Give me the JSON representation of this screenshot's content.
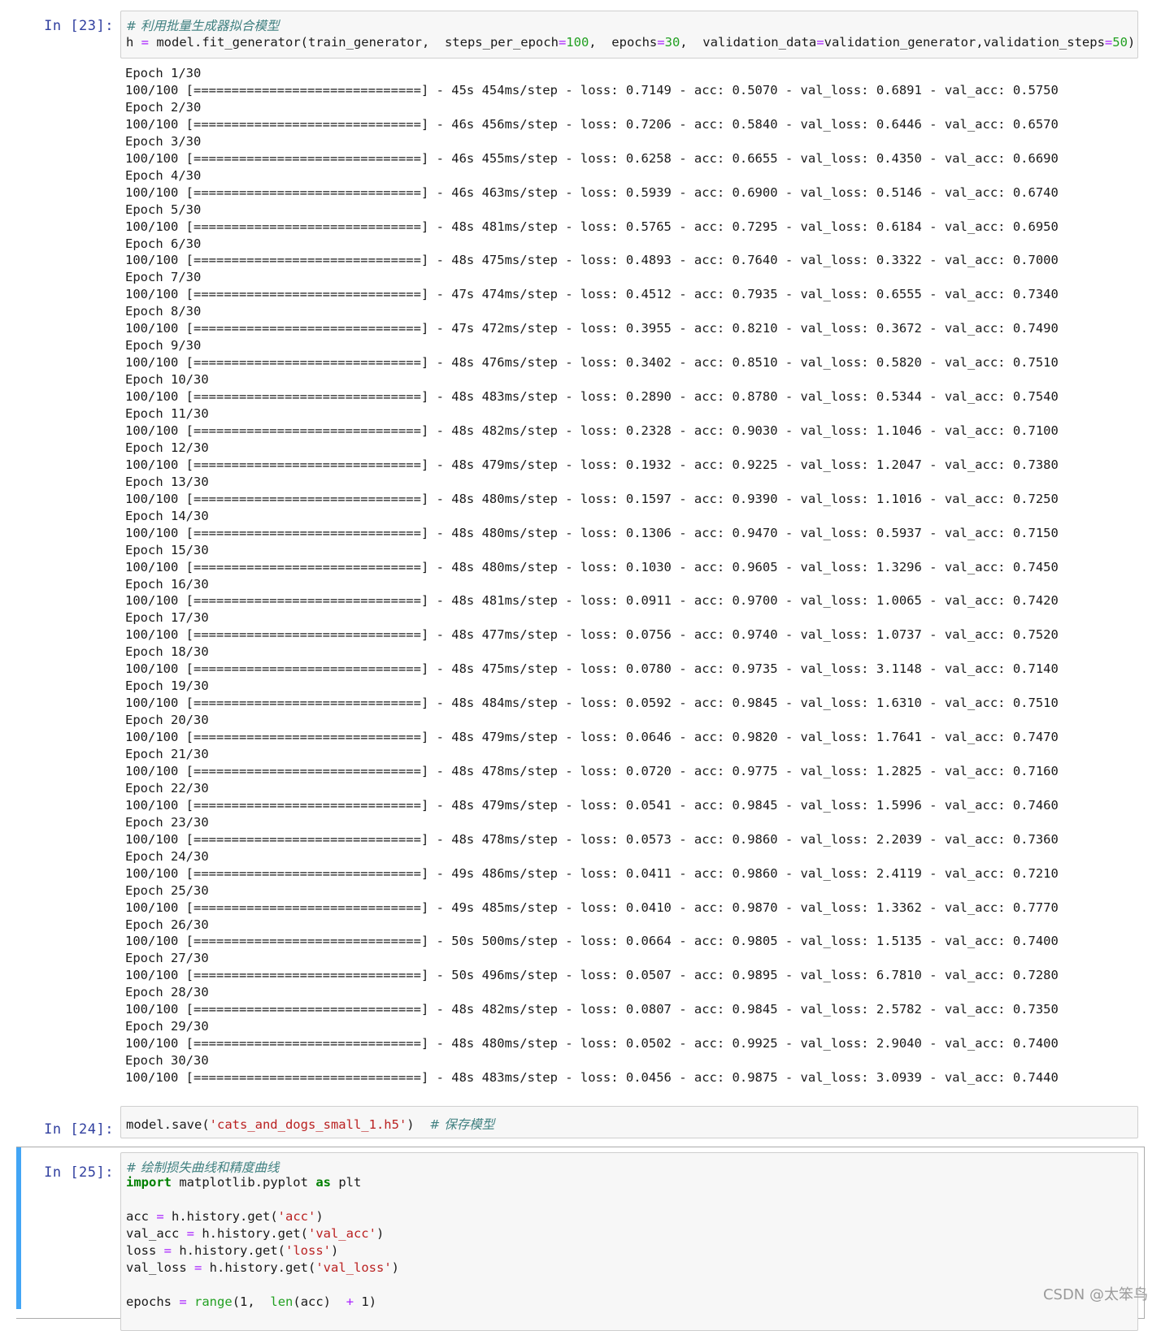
{
  "cells": [
    {
      "prompt": "In  [23]:",
      "code": {
        "comment": "# 利用批量生成器拟合模型",
        "line_prefix": "h ",
        "eq": "=",
        "call": " model.fit_generator(train_generator,  steps_per_epoch",
        "eq2": "=",
        "spe": "100",
        "c1": ",  epochs",
        "eq3": "=",
        "ep": "30",
        "c2": ",  validation_data",
        "eq4": "=",
        "vd": "validation_generator,validation_steps",
        "eq5": "=",
        "vs": "50",
        "close": ")"
      }
    },
    {
      "prompt": "In  [24]:",
      "code": {
        "pre": "model.save(",
        "str": "'cats_and_dogs_small_1.h5'",
        "post": ")  ",
        "comment": "# 保存模型"
      }
    },
    {
      "prompt": "In  [25]:",
      "code": {
        "comment": "# 绘制损失曲线和精度曲线",
        "import_kw": "import",
        "import_mod": " matplotlib.pyplot ",
        "as_kw": "as",
        "import_alias": " plt",
        "l1_pre": "acc ",
        "l1_post": " h.history.get(",
        "l1_str": "'acc'",
        "l2_pre": "val_acc ",
        "l2_post": " h.history.get(",
        "l2_str": "'val_acc'",
        "l3_pre": "loss ",
        "l3_post": " h.history.get(",
        "l3_str": "'loss'",
        "l4_pre": "val_loss ",
        "l4_post": " h.history.get(",
        "l4_str": "'val_loss'",
        "l5_pre": "epochs ",
        "l5_fn": "range",
        "l5_a": "(1,  ",
        "l5_fn2": "len",
        "l5_b": "(acc)  ",
        "l5_plus": "+",
        "l5_c": " 1)",
        "eq": "=",
        "close": ")"
      }
    }
  ],
  "training_output": [
    {
      "epoch": "Epoch 1/30",
      "progress": "100/100 [==============================] - 45s 454ms/step - loss: 0.7149 - acc: 0.5070 - val_loss: 0.6891 - val_acc: 0.5750"
    },
    {
      "epoch": "Epoch 2/30",
      "progress": "100/100 [==============================] - 46s 456ms/step - loss: 0.7206 - acc: 0.5840 - val_loss: 0.6446 - val_acc: 0.6570"
    },
    {
      "epoch": "Epoch 3/30",
      "progress": "100/100 [==============================] - 46s 455ms/step - loss: 0.6258 - acc: 0.6655 - val_loss: 0.4350 - val_acc: 0.6690"
    },
    {
      "epoch": "Epoch 4/30",
      "progress": "100/100 [==============================] - 46s 463ms/step - loss: 0.5939 - acc: 0.6900 - val_loss: 0.5146 - val_acc: 0.6740"
    },
    {
      "epoch": "Epoch 5/30",
      "progress": "100/100 [==============================] - 48s 481ms/step - loss: 0.5765 - acc: 0.7295 - val_loss: 0.6184 - val_acc: 0.6950"
    },
    {
      "epoch": "Epoch 6/30",
      "progress": "100/100 [==============================] - 48s 475ms/step - loss: 0.4893 - acc: 0.7640 - val_loss: 0.3322 - val_acc: 0.7000"
    },
    {
      "epoch": "Epoch 7/30",
      "progress": "100/100 [==============================] - 47s 474ms/step - loss: 0.4512 - acc: 0.7935 - val_loss: 0.6555 - val_acc: 0.7340"
    },
    {
      "epoch": "Epoch 8/30",
      "progress": "100/100 [==============================] - 47s 472ms/step - loss: 0.3955 - acc: 0.8210 - val_loss: 0.3672 - val_acc: 0.7490"
    },
    {
      "epoch": "Epoch 9/30",
      "progress": "100/100 [==============================] - 48s 476ms/step - loss: 0.3402 - acc: 0.8510 - val_loss: 0.5820 - val_acc: 0.7510"
    },
    {
      "epoch": "Epoch 10/30",
      "progress": "100/100 [==============================] - 48s 483ms/step - loss: 0.2890 - acc: 0.8780 - val_loss: 0.5344 - val_acc: 0.7540"
    },
    {
      "epoch": "Epoch 11/30",
      "progress": "100/100 [==============================] - 48s 482ms/step - loss: 0.2328 - acc: 0.9030 - val_loss: 1.1046 - val_acc: 0.7100"
    },
    {
      "epoch": "Epoch 12/30",
      "progress": "100/100 [==============================] - 48s 479ms/step - loss: 0.1932 - acc: 0.9225 - val_loss: 1.2047 - val_acc: 0.7380"
    },
    {
      "epoch": "Epoch 13/30",
      "progress": "100/100 [==============================] - 48s 480ms/step - loss: 0.1597 - acc: 0.9390 - val_loss: 1.1016 - val_acc: 0.7250"
    },
    {
      "epoch": "Epoch 14/30",
      "progress": "100/100 [==============================] - 48s 480ms/step - loss: 0.1306 - acc: 0.9470 - val_loss: 0.5937 - val_acc: 0.7150"
    },
    {
      "epoch": "Epoch 15/30",
      "progress": "100/100 [==============================] - 48s 480ms/step - loss: 0.1030 - acc: 0.9605 - val_loss: 1.3296 - val_acc: 0.7450"
    },
    {
      "epoch": "Epoch 16/30",
      "progress": "100/100 [==============================] - 48s 481ms/step - loss: 0.0911 - acc: 0.9700 - val_loss: 1.0065 - val_acc: 0.7420"
    },
    {
      "epoch": "Epoch 17/30",
      "progress": "100/100 [==============================] - 48s 477ms/step - loss: 0.0756 - acc: 0.9740 - val_loss: 1.0737 - val_acc: 0.7520"
    },
    {
      "epoch": "Epoch 18/30",
      "progress": "100/100 [==============================] - 48s 475ms/step - loss: 0.0780 - acc: 0.9735 - val_loss: 3.1148 - val_acc: 0.7140"
    },
    {
      "epoch": "Epoch 19/30",
      "progress": "100/100 [==============================] - 48s 484ms/step - loss: 0.0592 - acc: 0.9845 - val_loss: 1.6310 - val_acc: 0.7510"
    },
    {
      "epoch": "Epoch 20/30",
      "progress": "100/100 [==============================] - 48s 479ms/step - loss: 0.0646 - acc: 0.9820 - val_loss: 1.7641 - val_acc: 0.7470"
    },
    {
      "epoch": "Epoch 21/30",
      "progress": "100/100 [==============================] - 48s 478ms/step - loss: 0.0720 - acc: 0.9775 - val_loss: 1.2825 - val_acc: 0.7160"
    },
    {
      "epoch": "Epoch 22/30",
      "progress": "100/100 [==============================] - 48s 479ms/step - loss: 0.0541 - acc: 0.9845 - val_loss: 1.5996 - val_acc: 0.7460"
    },
    {
      "epoch": "Epoch 23/30",
      "progress": "100/100 [==============================] - 48s 478ms/step - loss: 0.0573 - acc: 0.9860 - val_loss: 2.2039 - val_acc: 0.7360"
    },
    {
      "epoch": "Epoch 24/30",
      "progress": "100/100 [==============================] - 49s 486ms/step - loss: 0.0411 - acc: 0.9860 - val_loss: 2.4119 - val_acc: 0.7210"
    },
    {
      "epoch": "Epoch 25/30",
      "progress": "100/100 [==============================] - 49s 485ms/step - loss: 0.0410 - acc: 0.9870 - val_loss: 1.3362 - val_acc: 0.7770"
    },
    {
      "epoch": "Epoch 26/30",
      "progress": "100/100 [==============================] - 50s 500ms/step - loss: 0.0664 - acc: 0.9805 - val_loss: 1.5135 - val_acc: 0.7400"
    },
    {
      "epoch": "Epoch 27/30",
      "progress": "100/100 [==============================] - 50s 496ms/step - loss: 0.0507 - acc: 0.9895 - val_loss: 6.7810 - val_acc: 0.7280"
    },
    {
      "epoch": "Epoch 28/30",
      "progress": "100/100 [==============================] - 48s 482ms/step - loss: 0.0807 - acc: 0.9845 - val_loss: 2.5782 - val_acc: 0.7350"
    },
    {
      "epoch": "Epoch 29/30",
      "progress": "100/100 [==============================] - 48s 480ms/step - loss: 0.0502 - acc: 0.9925 - val_loss: 2.9040 - val_acc: 0.7400"
    },
    {
      "epoch": "Epoch 30/30",
      "progress": "100/100 [==============================] - 48s 483ms/step - loss: 0.0456 - acc: 0.9875 - val_loss: 3.0939 - val_acc: 0.7440"
    }
  ],
  "watermark": "CSDN @太笨鸟",
  "colors": {
    "prompt": "#303f9f",
    "comment": "#408080",
    "keyword": "#008000",
    "number": "#22a022",
    "string": "#ba2121",
    "active_cell_bar": "#42a5f5"
  }
}
